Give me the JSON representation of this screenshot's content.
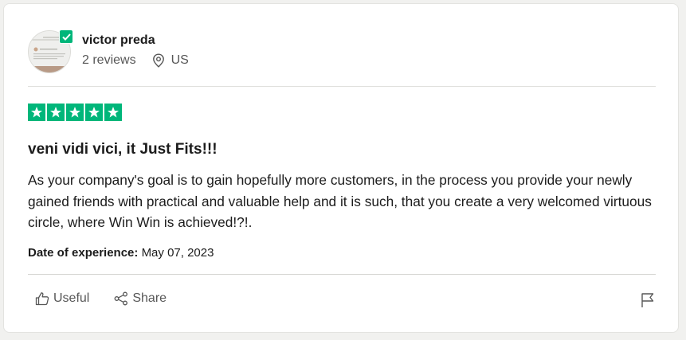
{
  "reviewer": {
    "name": "victor preda",
    "reviews_count": "2 reviews",
    "country": "US",
    "verified": true
  },
  "rating": {
    "stars": 5,
    "max": 5,
    "color": "#00b67a"
  },
  "review": {
    "title": "veni vidi vici, it Just Fits!!!",
    "text": "As your company's goal is to gain hopefully more customers, in the process you provide your newly gained friends with practical and valuable help and it is such, that you create a very welcomed virtuous circle, where Win Win is achieved!?!.",
    "date_label": "Date of experience:",
    "date_value": "May 07, 2023"
  },
  "actions": {
    "useful_label": "Useful",
    "share_label": "Share",
    "useful_icon": "thumbs-up-icon",
    "share_icon": "share-icon",
    "report_icon": "flag-icon"
  }
}
